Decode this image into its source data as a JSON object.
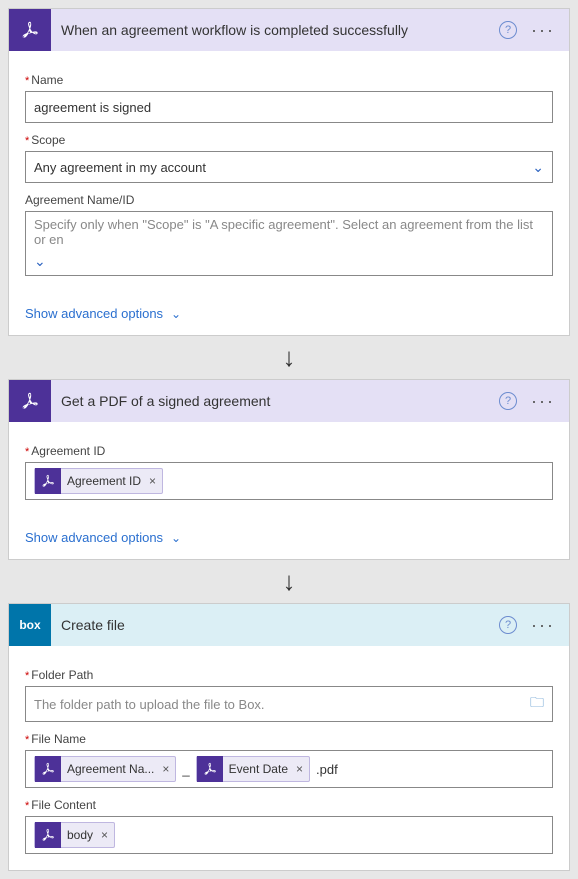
{
  "step1": {
    "title": "When an agreement workflow is completed successfully",
    "name_label": "Name",
    "name_value": "agreement is signed",
    "scope_label": "Scope",
    "scope_value": "Any agreement in my account",
    "agreement_label": "Agreement Name/ID",
    "agreement_placeholder": "Specify only when \"Scope\" is \"A specific agreement\". Select an agreement from the list or en",
    "show_advanced": "Show advanced options"
  },
  "step2": {
    "title": "Get a PDF of a signed agreement",
    "agreement_id_label": "Agreement ID",
    "token_agreement_id": "Agreement ID",
    "show_advanced": "Show advanced options"
  },
  "step3": {
    "title": "Create file",
    "box_logo": "box",
    "folder_label": "Folder Path",
    "folder_placeholder": "The folder path to upload the file to Box.",
    "filename_label": "File Name",
    "token_agreement_name": "Agreement Na...",
    "token_event_date": "Event Date",
    "filename_sep1": "_",
    "filename_suffix": ".pdf",
    "filecontent_label": "File Content",
    "token_body": "body"
  },
  "icons": {
    "help": "?",
    "more": "···",
    "close": "×",
    "chev": "⌄"
  }
}
